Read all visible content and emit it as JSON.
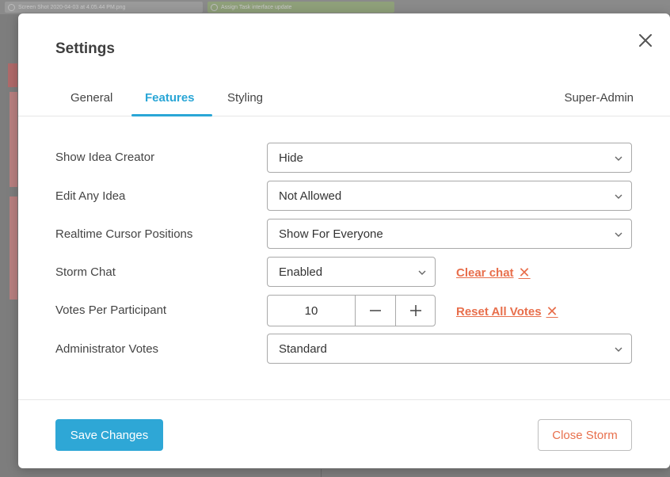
{
  "background": {
    "tab1_label": "Screen Shot 2020-04-03 at 4.05.44 PM.png",
    "tab2_label": "Assign Task interface update"
  },
  "modal": {
    "title": "Settings",
    "close_icon": "close-icon"
  },
  "tabs": [
    {
      "label": "General",
      "active": false
    },
    {
      "label": "Features",
      "active": true
    },
    {
      "label": "Styling",
      "active": false
    },
    {
      "label": "Super-Admin",
      "active": false
    }
  ],
  "settings": {
    "show_idea_creator": {
      "label": "Show Idea Creator",
      "value": "Hide"
    },
    "edit_any_idea": {
      "label": "Edit Any Idea",
      "value": "Not Allowed"
    },
    "realtime_cursor": {
      "label": "Realtime Cursor Positions",
      "value": "Show For Everyone"
    },
    "storm_chat": {
      "label": "Storm Chat",
      "value": "Enabled",
      "action": "Clear chat"
    },
    "votes_per_participant": {
      "label": "Votes Per Participant",
      "value": "10",
      "action": "Reset All Votes"
    },
    "administrator_votes": {
      "label": "Administrator Votes",
      "value": "Standard"
    }
  },
  "footer": {
    "save_label": "Save Changes",
    "close_label": "Close Storm"
  },
  "colors": {
    "accent": "#2aa6d6",
    "danger": "#e86f4c"
  }
}
